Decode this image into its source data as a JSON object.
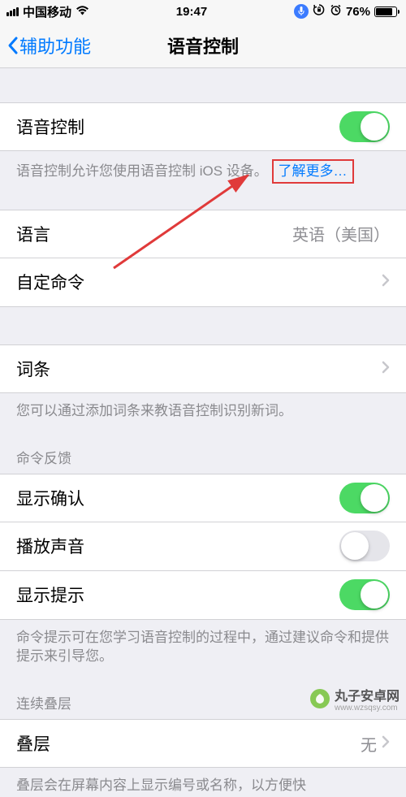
{
  "status": {
    "carrier": "中国移动",
    "time": "19:47",
    "battery_pct": "76%"
  },
  "nav": {
    "back": "辅助功能",
    "title": "语音控制"
  },
  "main_toggle": {
    "label": "语音控制"
  },
  "main_footer": {
    "text": "语音控制允许您使用语音控制 iOS 设备。",
    "learn_more": "了解更多…"
  },
  "rows": {
    "language": {
      "label": "语言",
      "value": "英语（美国）"
    },
    "custom_commands": {
      "label": "自定命令"
    },
    "vocabulary": {
      "label": "词条"
    }
  },
  "vocab_footer": "您可以通过添加词条来教语音控制识别新词。",
  "feedback_header": "命令反馈",
  "feedback_rows": {
    "show_confirm": {
      "label": "显示确认"
    },
    "play_sound": {
      "label": "播放声音"
    },
    "show_hint": {
      "label": "显示提示"
    }
  },
  "feedback_footer": "命令提示可在您学习语音控制的过程中，通过建议命令和提供提示来引导您。",
  "overlay_header": "连续叠层",
  "overlay_rows": {
    "overlay": {
      "label": "叠层",
      "value": "无"
    }
  },
  "overlay_footer": "叠层会在屏幕内容上显示编号或名称，以方便快",
  "watermark": {
    "title": "丸子安卓网",
    "url": "www.wzsqsy.com"
  }
}
